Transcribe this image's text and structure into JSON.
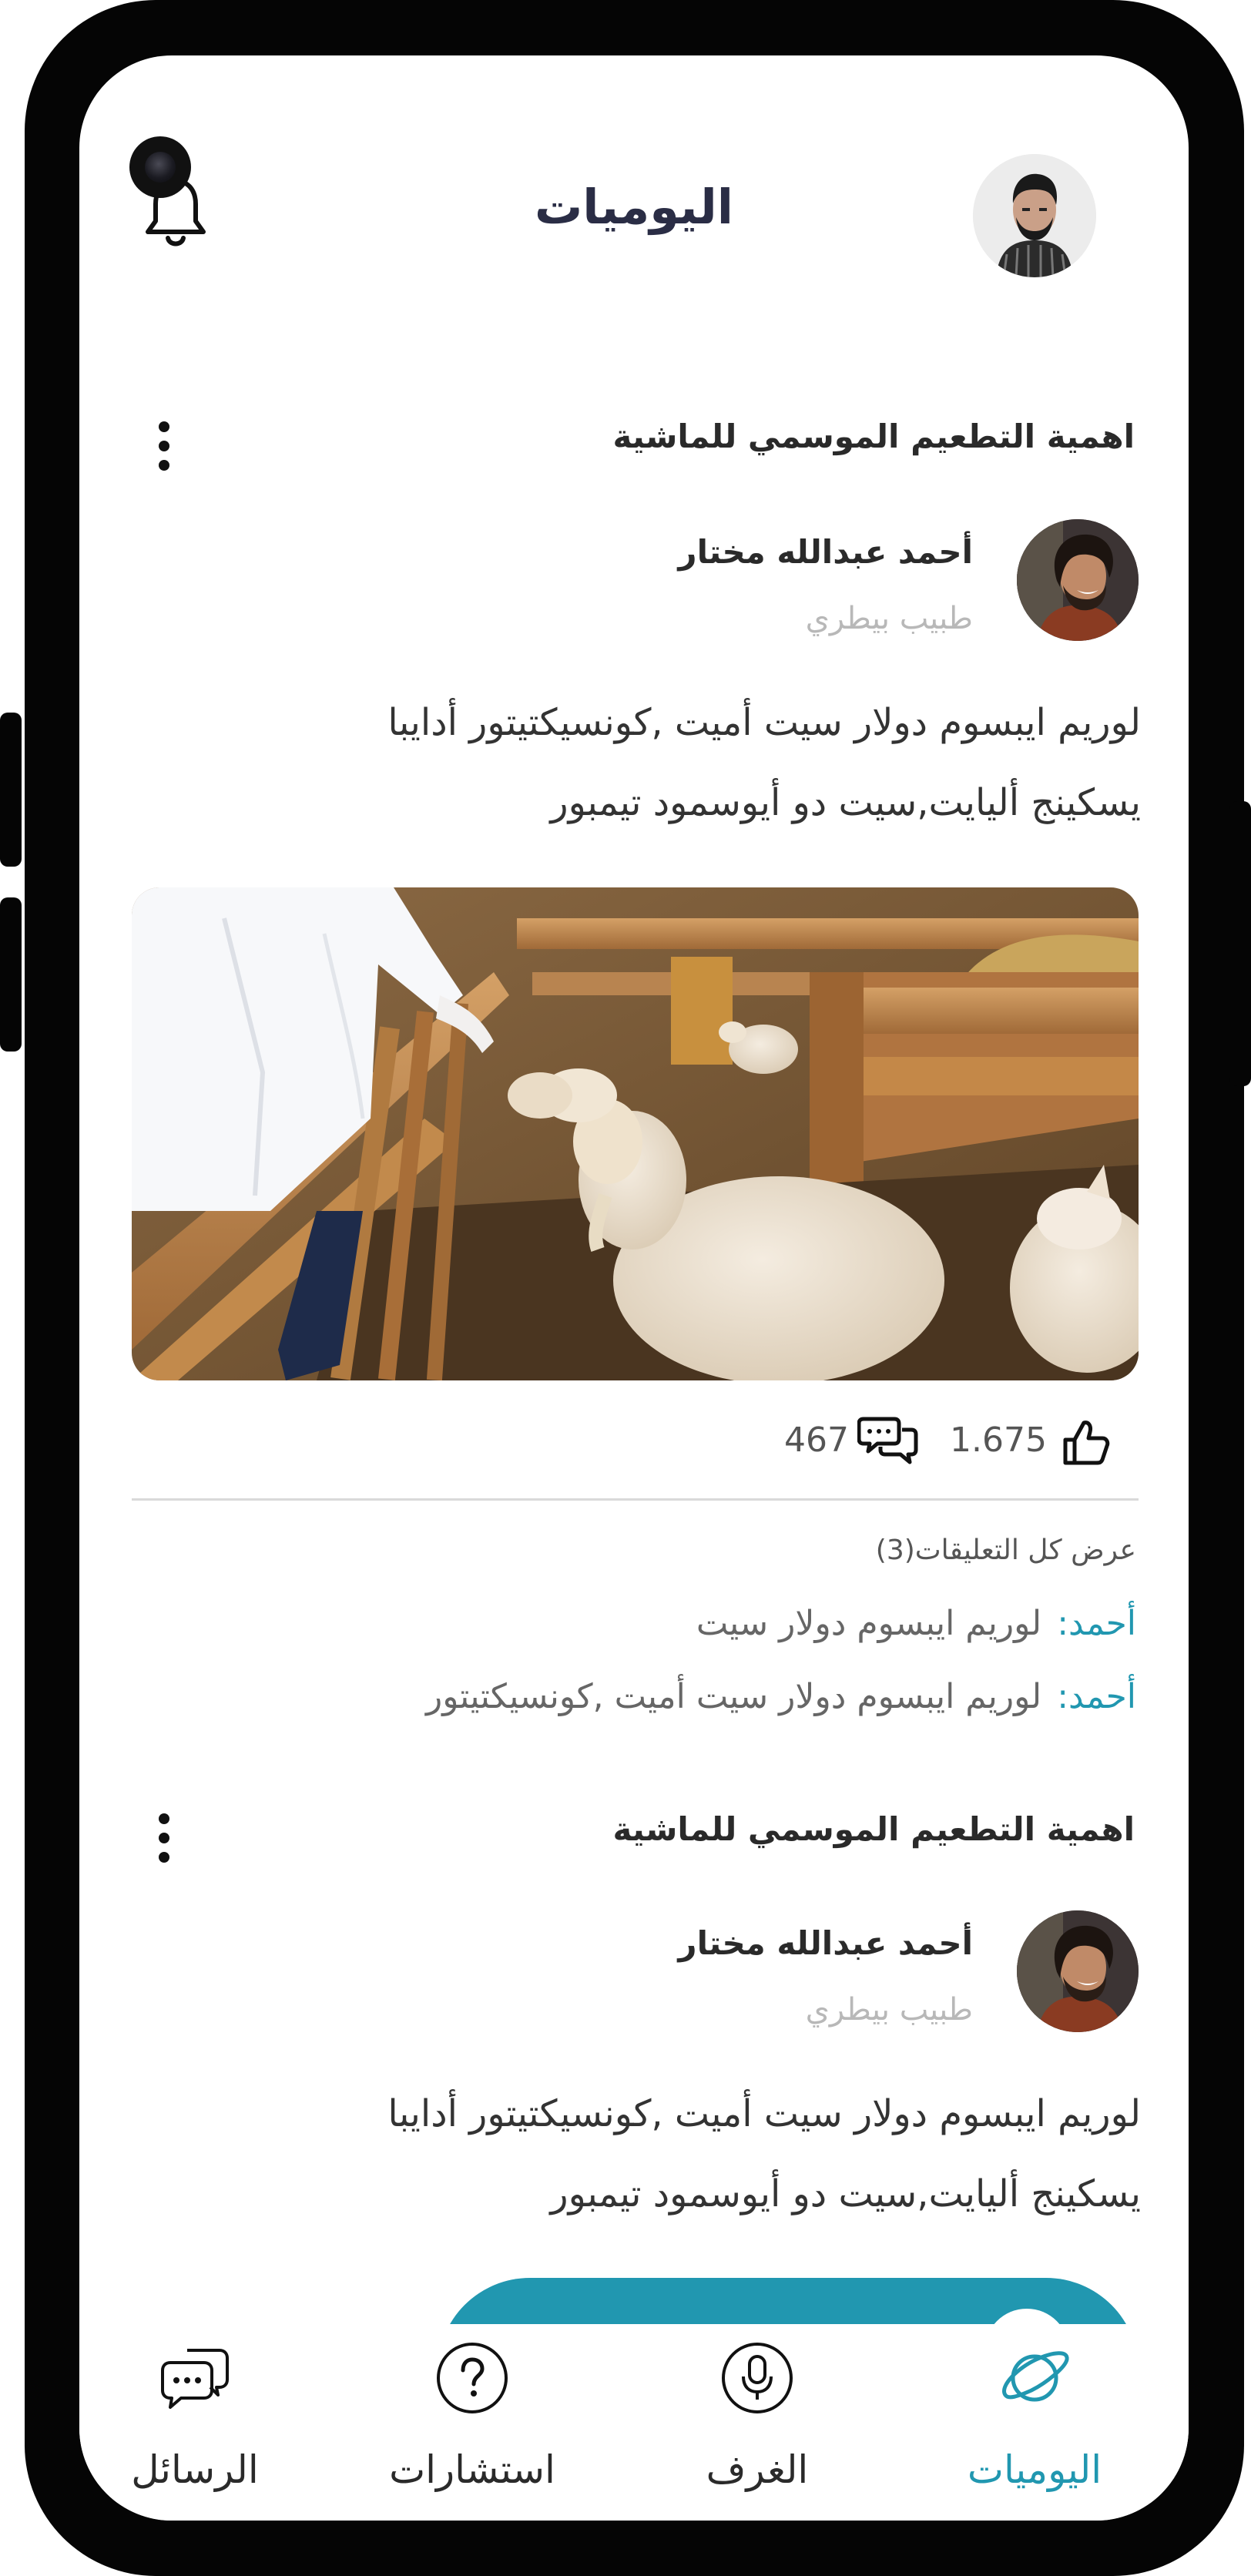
{
  "header": {
    "title": "اليوميات",
    "notification_icon": "bell-icon",
    "avatar_icon": "user-avatar"
  },
  "posts": [
    {
      "title": "اهمية التطعيم الموسمي للماشية",
      "author_name": "أحمد عبدالله مختار",
      "author_role": "طبيب بيطري",
      "body_line1": "لوريم ايبسوم دولار سيت أميت ,كونسيكتيتور أدايبا",
      "body_line2": "يسكينج أليايت,سيت دو أيوسمود تيمبور",
      "image_alt": "sheep-in-pen-photo",
      "likes": "1.675",
      "comments_count": "467",
      "view_all_comments": "عرض كل التعليقات(3)",
      "comments": [
        {
          "name": "أحمد:",
          "text": "لوريم ايبسوم دولار سيت"
        },
        {
          "name": "أحمد:",
          "text": "لوريم ايبسوم دولار سيت أميت ,كونسيكتيتور"
        }
      ]
    },
    {
      "title": "اهمية التطعيم الموسمي للماشية",
      "author_name": "أحمد عبدالله مختار",
      "author_role": "طبيب بيطري",
      "body_line1": "لوريم ايبسوم دولار سيت أميت ,كونسيكتيتور أدايبا",
      "body_line2": "يسكينج أليايت,سيت دو أيوسمود تيمبور"
    }
  ],
  "bottom_nav": {
    "items": [
      {
        "label": "اليوميات",
        "icon": "planet-icon",
        "active": true
      },
      {
        "label": "الغرف",
        "icon": "microphone-icon",
        "active": false
      },
      {
        "label": "استشارات",
        "icon": "question-icon",
        "active": false
      },
      {
        "label": "الرسائل",
        "icon": "chat-bubbles-icon",
        "active": false
      }
    ]
  },
  "colors": {
    "accent": "#2197b0",
    "title": "#2a2d45",
    "frame": "#050505"
  }
}
